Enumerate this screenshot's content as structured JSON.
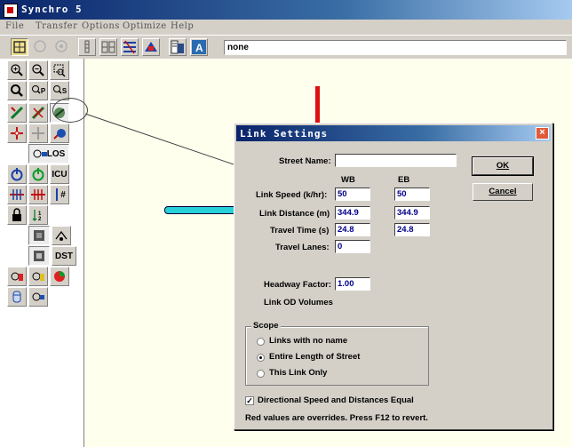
{
  "window": {
    "title": "Synchro 5"
  },
  "menu": [
    "File",
    "Transfer",
    "Options",
    "Optimize",
    "Help"
  ],
  "toolbar": {
    "field_value": "none",
    "accent": "#f0e08c"
  },
  "left_panel": {
    "labels": {
      "los": "LOS",
      "icu": "ICU",
      "dst": "DST",
      "hash": "#",
      "q_p": "P",
      "q_s": "S"
    }
  },
  "canvas": {
    "bg": "#ffffee",
    "link_colors": {
      "northbound": "#e01010",
      "westbound": "#27d0d8"
    }
  },
  "dialog": {
    "title": "Link Settings",
    "close_glyph": "×",
    "street_name_label": "Street Name:",
    "street_name_value": "",
    "col_wb": "WB",
    "col_eb": "EB",
    "rows": {
      "link_speed": {
        "label": "Link Speed (k/hr):",
        "wb": "50",
        "eb": "50"
      },
      "link_distance": {
        "label": "Link Distance (m)",
        "wb": "344.9",
        "eb": "344.9"
      },
      "travel_time": {
        "label": "Travel Time (s)",
        "wb": "24.8",
        "eb": "24.8"
      },
      "travel_lanes": {
        "label": "Travel Lanes:",
        "wb": "0"
      }
    },
    "headway_label": "Headway Factor:",
    "headway_value": "1.00",
    "od_label": "Link OD Volumes",
    "ok_label": "OK",
    "cancel_label": "Cancel",
    "scope": {
      "legend": "Scope",
      "options": [
        "Links with no name",
        "Entire Length of Street",
        "This Link Only"
      ],
      "selected": "Entire Length of Street"
    },
    "directional_label": "Directional Speed and Distances Equal",
    "directional_checked": "✓",
    "footer": "Red values are overrides.  Press F12 to revert."
  }
}
